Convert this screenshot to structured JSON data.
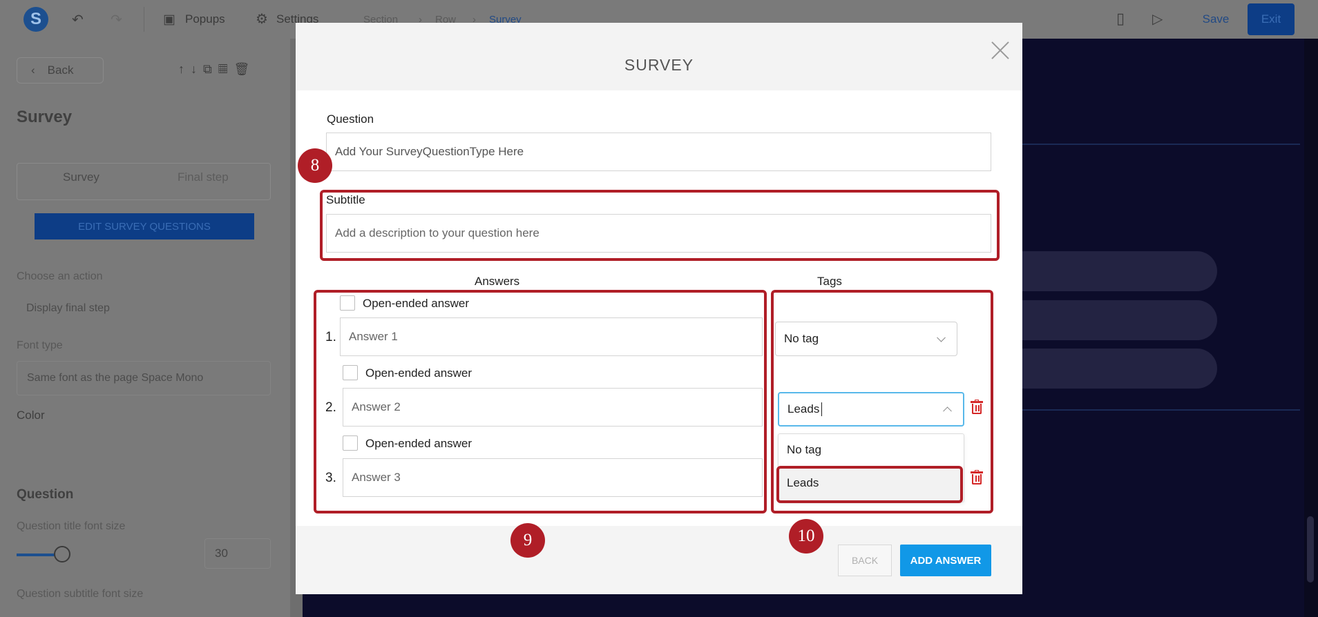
{
  "topbar": {
    "logo": "S",
    "popups_label": "Popups",
    "settings_label": "Settings",
    "breadcrumb": [
      "Section",
      "Row",
      "Survey"
    ],
    "save_label": "Save",
    "exit_label": "Exit"
  },
  "sidebar": {
    "back_label": "Back",
    "title": "Survey",
    "tabs": [
      "Survey",
      "Final step"
    ],
    "edit_button": "EDIT SURVEY QUESTIONS",
    "action_label": "Choose an action",
    "action_value": "Display final step",
    "font_label": "Font type",
    "font_value": "Same font as the page Space Mono",
    "color_label": "Color",
    "section_title": "Question",
    "title_size_label": "Question title font size",
    "title_size_value": "30",
    "subtitle_size_label": "Question subtitle font size"
  },
  "modal": {
    "title": "SURVEY",
    "question_label": "Question",
    "question_value": "Add Your SurveyQuestionType Here",
    "subtitle_label": "Subtitle",
    "subtitle_placeholder": "Add a description to your question here",
    "answers_header": "Answers",
    "tags_header": "Tags",
    "answers": [
      {
        "number": "1.",
        "open_ended_label": "Open-ended answer",
        "placeholder": "Answer 1",
        "tag": "No tag"
      },
      {
        "number": "2.",
        "open_ended_label": "Open-ended answer",
        "placeholder": "Answer 2",
        "tag": "Leads"
      },
      {
        "number": "3.",
        "open_ended_label": "Open-ended answer",
        "placeholder": "Answer 3",
        "tag": ""
      }
    ],
    "dropdown_options": [
      "No tag",
      "Leads"
    ],
    "back_button": "BACK",
    "add_answer_button": "ADD ANSWER"
  },
  "annotations": {
    "steps": [
      "8",
      "9",
      "10"
    ],
    "color": "#b01e27"
  },
  "colors": {
    "accent": "#1198e7",
    "focus": "#58b8ea",
    "delete": "#d52828"
  }
}
